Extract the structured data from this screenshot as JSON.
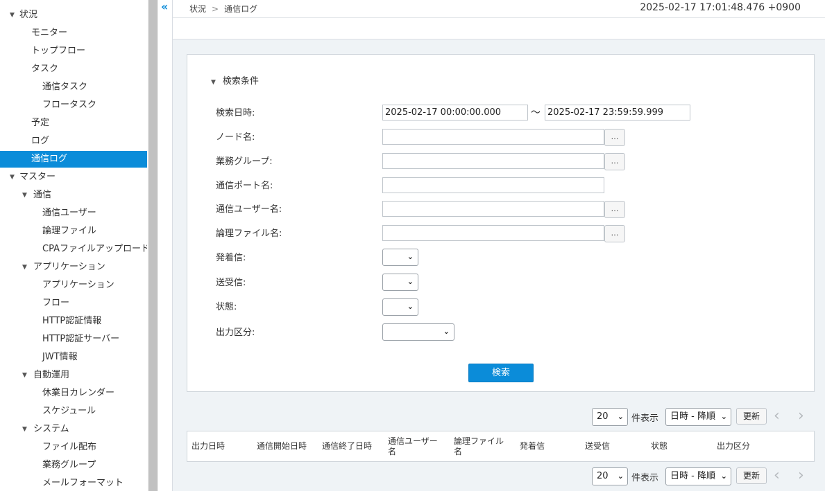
{
  "sidebar": {
    "items": [
      {
        "label": "状況",
        "level": 0,
        "tri": true
      },
      {
        "label": "モニター",
        "level": 1
      },
      {
        "label": "トップフロー",
        "level": 1
      },
      {
        "label": "タスク",
        "level": 1
      },
      {
        "label": "通信タスク",
        "level": 2
      },
      {
        "label": "フロータスク",
        "level": 2
      },
      {
        "label": "予定",
        "level": 1
      },
      {
        "label": "ログ",
        "level": 1
      },
      {
        "label": "通信ログ",
        "level": 1,
        "active": true
      },
      {
        "label": "マスター",
        "level": 0,
        "tri": true
      },
      {
        "label": "通信",
        "level": 1,
        "tri": true
      },
      {
        "label": "通信ユーザー",
        "level": 2
      },
      {
        "label": "論理ファイル",
        "level": 2
      },
      {
        "label": "CPAファイルアップロード",
        "level": 2
      },
      {
        "label": "アプリケーション",
        "level": 1,
        "tri": true
      },
      {
        "label": "アプリケーション",
        "level": 2
      },
      {
        "label": "フロー",
        "level": 2
      },
      {
        "label": "HTTP認証情報",
        "level": 2
      },
      {
        "label": "HTTP認証サーバー",
        "level": 2
      },
      {
        "label": "JWT情報",
        "level": 2
      },
      {
        "label": "自動運用",
        "level": 1,
        "tri": true
      },
      {
        "label": "休業日カレンダー",
        "level": 2
      },
      {
        "label": "スケジュール",
        "level": 2
      },
      {
        "label": "システム",
        "level": 1,
        "tri": true
      },
      {
        "label": "ファイル配布",
        "level": 2
      },
      {
        "label": "業務グループ",
        "level": 2
      },
      {
        "label": "メールフォーマット",
        "level": 2
      }
    ]
  },
  "header": {
    "breadcrumb": [
      "状況",
      "通信ログ"
    ],
    "breadcrumb_sep": ">",
    "clock": "2025-02-17 17:01:48.476 +0900",
    "collapse_glyph": "«"
  },
  "search": {
    "section_title": "検索条件",
    "date_label": "検索日時:",
    "date_from": "2025-02-17 00:00:00.000",
    "date_to": "2025-02-17 23:59:59.999",
    "tilde": "～",
    "node_label": "ノード名:",
    "group_label": "業務グループ:",
    "port_label": "通信ポート名:",
    "user_label": "通信ユーザー名:",
    "file_label": "論理ファイル名:",
    "direction_label": "発着信:",
    "sendrecv_label": "送受信:",
    "status_label": "状態:",
    "output_label": "出力区分:",
    "browse_glyph": "…",
    "submit_label": "検索"
  },
  "pager": {
    "page_size": "20",
    "page_size_suffix": "件表示",
    "sort": "日時 - 降順",
    "refresh_label": "更新",
    "prev_glyph": "‹",
    "next_glyph": "›"
  },
  "table": {
    "columns": [
      "出力日時",
      "通信開始日時",
      "通信終了日時",
      "通信ユーザー名",
      "論理ファイル名",
      "発着信",
      "送受信",
      "状態",
      "出力区分"
    ]
  },
  "colors": {
    "accent": "#0b8cd9",
    "background": "#eff3f6"
  },
  "icons": {
    "tree_expanded": "▼",
    "select_chevron": "⌄"
  }
}
